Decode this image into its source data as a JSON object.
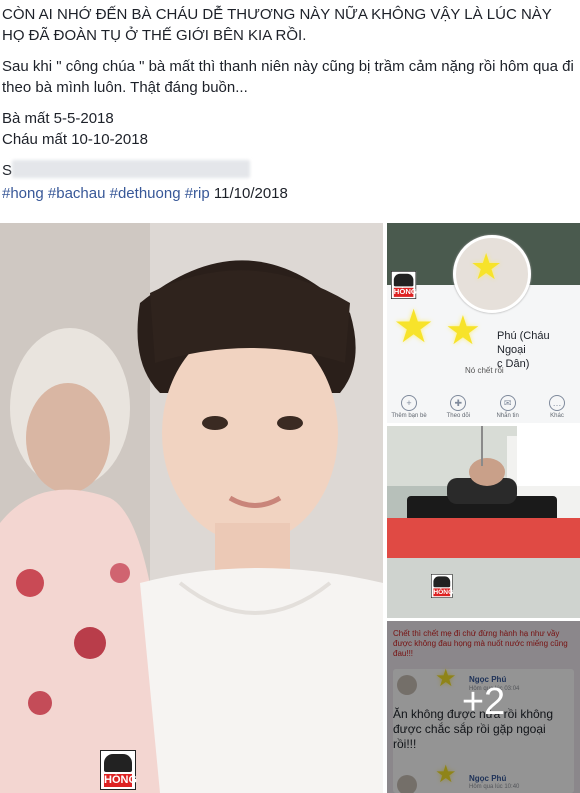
{
  "post": {
    "headline": "CÒN AI NHỚ ĐẾN BÀ CHÁU DỄ THƯƠNG NÀY NỮA KHÔNG VẬY LÀ LÚC NÀY HỌ ĐÃ ĐOÀN TỤ Ở THẾ GIỚI BÊN KIA RỒI.",
    "body": "Sau khi \" công chúa \" bà mất thì thanh niên này cũng bị trầm cảm nặng rồi hôm qua đi theo bà mình luôn. Thật đáng buồn...",
    "line_grandma": "Bà mất 5-5-2018",
    "line_grandson": "Cháu mất 10-10-2018",
    "source_prefix": "S",
    "hashtags": [
      "#hong",
      "#bachau",
      "#dethuong",
      "#rip"
    ],
    "date": "11/10/2018"
  },
  "gallery": {
    "watermark": "HÓNG",
    "profile_thumb": {
      "name_visible": "Phú (Cháu Ngoại",
      "name_line2": "c Dân)",
      "status": "Nó chết rồi",
      "actions": [
        {
          "icon": "add-friend-icon",
          "glyph": "+",
          "label": "Thêm bạn bè"
        },
        {
          "icon": "follow-icon",
          "glyph": "✚",
          "label": "Theo dõi"
        },
        {
          "icon": "messenger-icon",
          "glyph": "✉",
          "label": "Nhắn tin"
        },
        {
          "icon": "more-icon",
          "glyph": "…",
          "label": "Khác"
        }
      ]
    },
    "post_thumb": {
      "caption": "Chết thì chết mẹ đi chứ đừng hành hạ như vầy được không đau họng mà nuốt nước miếng cũng đau!!!",
      "author_1": "Ngọc Phú",
      "meta_1": "Hôm qua lúc 03:04",
      "text": "Ăn không được nữa rồi không được chắc sắp rồi gặp ngoại rồi!!!",
      "author_2": "Ngọc Phú",
      "meta_2": "Hôm qua lúc 10:40",
      "more_count": "+2"
    }
  },
  "colors": {
    "hashtag": "#385898",
    "text": "#1d2129",
    "star": "#f7e32a"
  }
}
